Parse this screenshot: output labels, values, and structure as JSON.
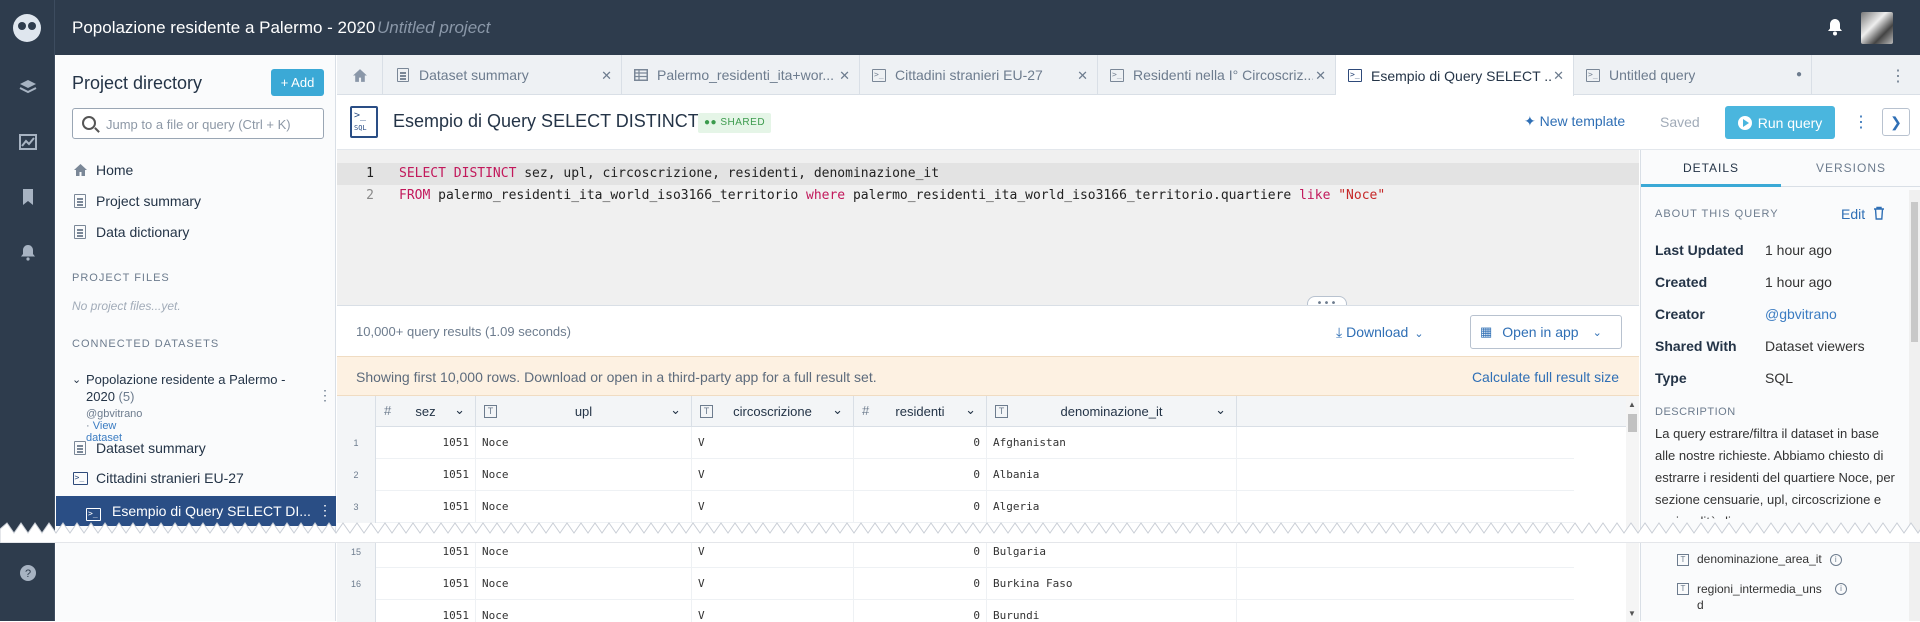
{
  "topbar": {
    "project_title": "Popolazione residente a Palermo - 2020",
    "separator": "›",
    "subtitle": "Untitled project"
  },
  "sidebar": {
    "heading": "Project directory",
    "add_label": "+ Add",
    "search_placeholder": "Jump to a file or query (Ctrl + K)",
    "nav": [
      {
        "label": "Home",
        "icon": "home-icon"
      },
      {
        "label": "Project summary",
        "icon": "document-icon"
      },
      {
        "label": "Data dictionary",
        "icon": "document-icon"
      }
    ],
    "project_files_heading": "PROJECT FILES",
    "no_files": "No project files...yet.",
    "connected_heading": "CONNECTED DATASETS",
    "dataset": {
      "title": "Popolazione residente a Palermo - 2020",
      "count": "(5)",
      "owner": "@gbvitrano",
      "meta_sep": " · ",
      "view_link": "View dataset"
    },
    "dataset_items": [
      {
        "label": "Dataset summary",
        "icon": "document-icon"
      },
      {
        "label": "Cittadini stranieri EU-27",
        "icon": "sql-icon"
      },
      {
        "label": "Esempio di Query SELECT DI...",
        "icon": "sql-icon",
        "selected": true
      }
    ]
  },
  "tabs": [
    {
      "label": "Dataset summary",
      "icon": "document-icon"
    },
    {
      "label": "Palermo_residenti_ita+wor...",
      "icon": "table-icon"
    },
    {
      "label": "Cittadini stranieri EU-27",
      "icon": "sql-icon"
    },
    {
      "label": "Residenti nella I° Circoscriz...",
      "icon": "sql-icon"
    },
    {
      "label": "Esempio di Query SELECT ...",
      "icon": "sql-icon",
      "active": true
    },
    {
      "label": "Untitled query",
      "icon": "sql-icon",
      "unsaved": true
    }
  ],
  "query": {
    "title": "Esempio di Query SELECT DISTINCT",
    "shared_badge": "SHARED",
    "new_template": "New template",
    "saved": "Saved",
    "run": "Run query",
    "lines": [
      {
        "n": "1",
        "parts": [
          [
            "kw",
            "SELECT DISTINCT"
          ],
          [
            "tx",
            " sez, upl, circoscrizione, residenti, denominazione_it"
          ]
        ]
      },
      {
        "n": "2",
        "parts": [
          [
            "kw",
            "FROM"
          ],
          [
            "tx",
            " palermo_residenti_ita_world_iso3166_territorio "
          ],
          [
            "kw",
            "where"
          ],
          [
            "tx",
            " palermo_residenti_ita_world_iso3166_territorio.quartiere "
          ],
          [
            "kw",
            "like"
          ],
          [
            "tx",
            " "
          ],
          [
            "str",
            "\"Noce\""
          ]
        ]
      }
    ]
  },
  "results": {
    "count_text": "10,000+ query results (1.09 seconds)",
    "download": "Download",
    "open_in_app": "Open in app",
    "banner_text": "Showing first 10,000 rows. Download or open in a third-party app for a full result set.",
    "banner_action": "Calculate full result size",
    "columns": [
      {
        "name": "sez",
        "type": "#"
      },
      {
        "name": "upl",
        "type": "T"
      },
      {
        "name": "circoscrizione",
        "type": "T"
      },
      {
        "name": "residenti",
        "type": "#"
      },
      {
        "name": "denominazione_it",
        "type": "T"
      }
    ],
    "rows": [
      {
        "rn": "1",
        "sez": "1051",
        "upl": "Noce",
        "circ": "V",
        "res": "0",
        "den": "Afghanistan"
      },
      {
        "rn": "2",
        "sez": "1051",
        "upl": "Noce",
        "circ": "V",
        "res": "0",
        "den": "Albania"
      },
      {
        "rn": "3",
        "sez": "1051",
        "upl": "Noce",
        "circ": "V",
        "res": "0",
        "den": "Algeria"
      },
      {
        "rn": "15",
        "sez": "1051",
        "upl": "Noce",
        "circ": "V",
        "res": "0",
        "den": "Bulgaria"
      },
      {
        "rn": "16",
        "sez": "1051",
        "upl": "Noce",
        "circ": "V",
        "res": "0",
        "den": "Burkina Faso"
      },
      {
        "rn": "",
        "sez": "1051",
        "upl": "Noce",
        "circ": "V",
        "res": "0",
        "den": "Burundi"
      }
    ]
  },
  "details": {
    "tab_details": "DETAILS",
    "tab_versions": "VERSIONS",
    "about_heading": "ABOUT THIS QUERY",
    "edit": "Edit",
    "fields": [
      {
        "k": "Last Updated",
        "v": "1 hour ago"
      },
      {
        "k": "Created",
        "v": "1 hour ago"
      },
      {
        "k": "Creator",
        "v": "@gbvitrano",
        "link": true
      },
      {
        "k": "Shared With",
        "v": "Dataset viewers"
      },
      {
        "k": "Type",
        "v": "SQL"
      }
    ],
    "description_heading": "DESCRIPTION",
    "description": "La query estrare/filtra il dataset in base alle nostre richieste. Abbiamo chiesto di estrarre i residenti del quartiere Noce, per sezione censuarie, upl, circoscrizione e nazionalità di",
    "column_list": [
      {
        "name": "denominazione_area_it"
      },
      {
        "name": "regioni_intermedia_uns d"
      }
    ]
  },
  "colors": {
    "topbar": "#2e3c4d",
    "accent": "#3ba9d6",
    "selected_item": "#2a4e85",
    "banner": "#fdf1e2"
  }
}
